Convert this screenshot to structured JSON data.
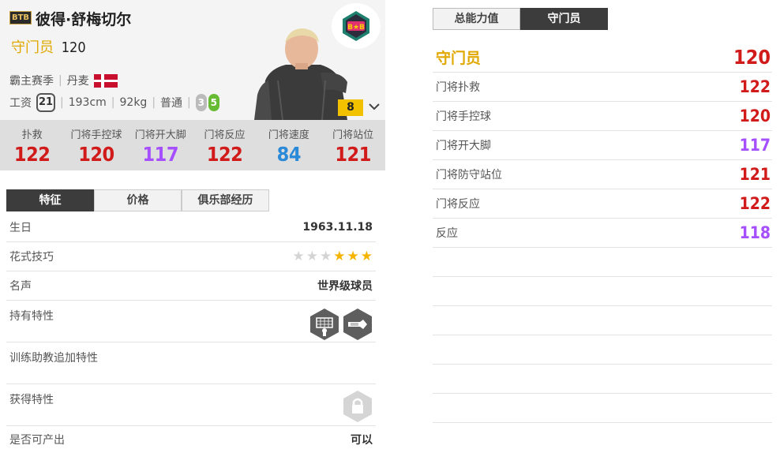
{
  "player": {
    "season_badge": "BTB",
    "name": "彼得·舒梅切尔",
    "position": "守门员",
    "overall": "120",
    "season": "霸主赛季",
    "nation": "丹麦",
    "wage_label": "工资",
    "wage": "21",
    "height": "193cm",
    "weight": "92kg",
    "body_type": "普通",
    "weak_foot": "3",
    "strong_foot": "5",
    "level": "8"
  },
  "stats_bar": [
    {
      "label": "扑救",
      "value": "122",
      "color": "red"
    },
    {
      "label": "门将手控球",
      "value": "120",
      "color": "red"
    },
    {
      "label": "门将开大脚",
      "value": "117",
      "color": "purple"
    },
    {
      "label": "门将反应",
      "value": "122",
      "color": "red"
    },
    {
      "label": "门将速度",
      "value": "84",
      "color": "blue"
    },
    {
      "label": "门将站位",
      "value": "121",
      "color": "red"
    }
  ],
  "left_tabs": [
    "特征",
    "价格",
    "俱乐部经历"
  ],
  "info": {
    "birthday_label": "生日",
    "birthday": "1963.11.18",
    "skill_label": "花式技巧",
    "skill_stars": 3,
    "skill_stars_max": 6,
    "fame_label": "名声",
    "fame": "世界级球员",
    "traits_label": "持有特性",
    "coach_traits_label": "训练助教追加特性",
    "acquired_traits_label": "获得特性",
    "producible_label": "是否可产出",
    "producible": "可以"
  },
  "right_tabs": [
    "总能力值",
    "守门员"
  ],
  "attributes": {
    "header_label": "守门员",
    "header_value": "120",
    "rows": [
      {
        "label": "门将扑救",
        "value": "122",
        "color": "red"
      },
      {
        "label": "门将手控球",
        "value": "120",
        "color": "red"
      },
      {
        "label": "门将开大脚",
        "value": "117",
        "color": "purple"
      },
      {
        "label": "门将防守站位",
        "value": "121",
        "color": "red"
      },
      {
        "label": "门将反应",
        "value": "122",
        "color": "red"
      },
      {
        "label": "反应",
        "value": "118",
        "color": "purple"
      }
    ]
  },
  "colors": {
    "red": "#d11a1a",
    "purple": "#a64fff",
    "blue": "#2a8ad8",
    "gold": "#e0a800"
  }
}
